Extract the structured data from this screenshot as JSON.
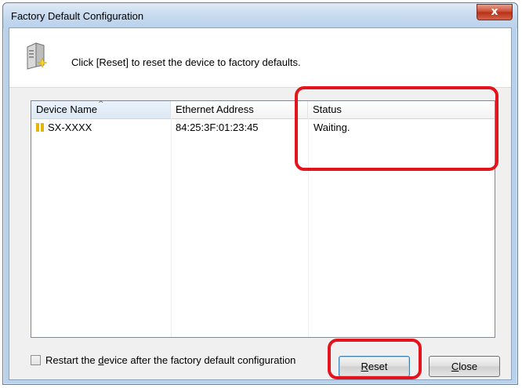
{
  "window": {
    "title": "Factory Default Configuration",
    "close_glyph": "x"
  },
  "header": {
    "icon": "device-reset-icon",
    "instruction": "Click [Reset] to reset the device to factory defaults."
  },
  "list": {
    "columns": [
      "Device Name",
      "Ethernet Address",
      "Status"
    ],
    "sorted_column": "Device Name",
    "rows": [
      {
        "icon": "device-icon",
        "name": "SX-XXXX",
        "ethernet": "84:25:3F:01:23:45",
        "status": "Waiting."
      }
    ]
  },
  "options": {
    "restart_pre": "Restart the ",
    "restart_accel": "d",
    "restart_post": "evice after the factory default configuration",
    "restart_checked": false
  },
  "buttons": {
    "reset_accel": "R",
    "reset_rest": "eset",
    "close_accel": "C",
    "close_rest": "lose"
  },
  "colors": {
    "highlight": "#e3141b",
    "titlebar": "#c4d8ee",
    "close_button": "#c8452c"
  }
}
